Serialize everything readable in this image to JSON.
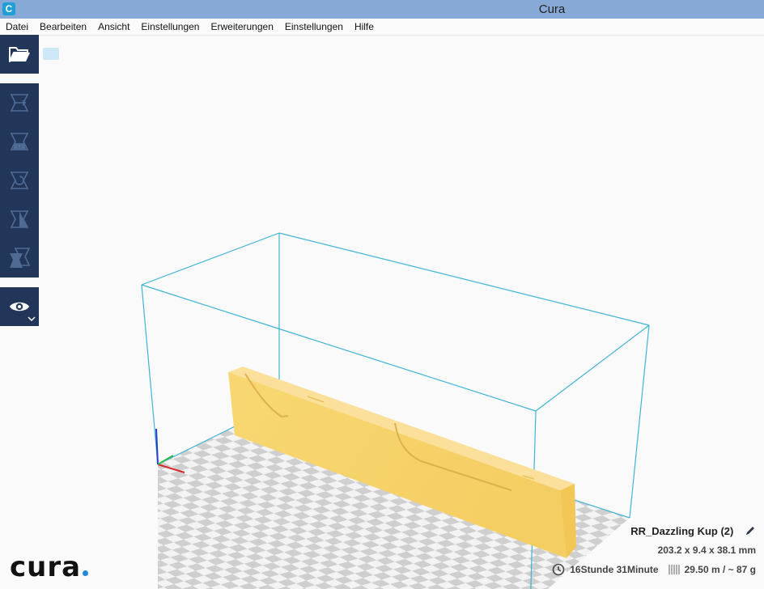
{
  "window": {
    "title": "Cura",
    "app_icon_letter": "C"
  },
  "menu": [
    "Datei",
    "Bearbeiten",
    "Ansicht",
    "Einstellungen",
    "Erweiterungen",
    "Einstellungen",
    "Hilfe"
  ],
  "toolbar": {
    "tools": [
      "move-icon",
      "scale-icon",
      "rotate-icon",
      "mirror-icon",
      "per-model-settings-icon"
    ],
    "open_icon": "folder-open-icon",
    "view_icon": "eye-icon"
  },
  "model": {
    "name": "RR_Dazzling Kup (2)",
    "dimensions": "203.2 x 9.4 x 38.1 mm"
  },
  "print": {
    "time": "16Stunde 31Minute",
    "material": "29.50 m / ~ 87 g"
  },
  "logo": {
    "text": "cura"
  },
  "colors": {
    "toolbar": "#213659",
    "model": "#f7d36b",
    "build_volume": "#3fb3d6",
    "accent": "#1c8ad7"
  }
}
